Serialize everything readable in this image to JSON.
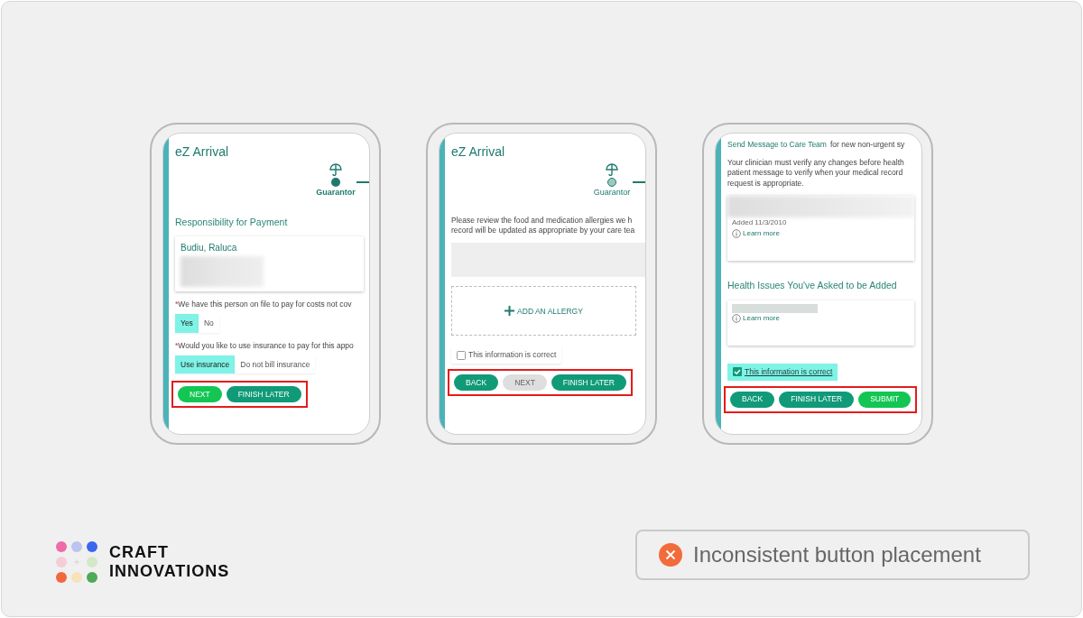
{
  "phones": [
    {
      "blocks": [
        {
          "kind": "title",
          "text": "eZ Arrival"
        },
        {
          "kind": "stepper",
          "label": "Guarantor",
          "current": true
        },
        {
          "kind": "heading",
          "text": "Responsibility for Payment"
        },
        {
          "kind": "person_card",
          "name": "Budiu, Raluca"
        },
        {
          "kind": "question",
          "marker": "*",
          "text": "We have this person on file to pay for costs not cov",
          "options": [
            {
              "label": "Yes",
              "selected": true
            },
            {
              "label": "No",
              "selected": false
            }
          ]
        },
        {
          "kind": "question",
          "marker": "*",
          "text": "Would you like to use insurance to pay for this appo",
          "options": [
            {
              "label": "Use insurance",
              "selected": true
            },
            {
              "label": "Do not bill insurance",
              "selected": false
            }
          ]
        }
      ],
      "buttons": [
        {
          "label": "NEXT",
          "kind": "primary"
        },
        {
          "label": "FINISH LATER",
          "kind": "secondary"
        }
      ]
    },
    {
      "blocks": [
        {
          "kind": "title",
          "text": "eZ Arrival"
        },
        {
          "kind": "stepper",
          "label": "Guarantor",
          "current": false
        },
        {
          "kind": "paragraph",
          "lines": [
            "Please review the food and medication allergies we h",
            "record will be updated as appropriate by your care tea"
          ]
        },
        {
          "kind": "empty_list"
        },
        {
          "kind": "add_box",
          "text": "ADD AN ALLERGY"
        },
        {
          "kind": "checkbox",
          "label": "This information is correct",
          "checked": false
        }
      ],
      "buttons": [
        {
          "label": "BACK",
          "kind": "secondary"
        },
        {
          "label": "NEXT",
          "kind": "disabled"
        },
        {
          "label": "FINISH LATER",
          "kind": "secondary"
        }
      ]
    },
    {
      "blocks": [
        {
          "kind": "link_line",
          "link": "Send Message to Care Team",
          "text": "for new non-urgent sy"
        },
        {
          "kind": "paragraph",
          "lines": [
            "Your clinician must verify any changes before health",
            "patient message to verify when your medical record",
            "request is appropriate."
          ]
        },
        {
          "kind": "item_card",
          "added": "Added 11/3/2010",
          "link": "Learn more"
        },
        {
          "kind": "heading",
          "text": "Health Issues You've Asked to be Added"
        },
        {
          "kind": "item_card",
          "link": "Learn more"
        },
        {
          "kind": "checkbox",
          "label": "This information is correct",
          "checked": true
        }
      ],
      "buttons": [
        {
          "label": "BACK",
          "kind": "secondary"
        },
        {
          "label": "FINISH LATER",
          "kind": "secondary"
        },
        {
          "label": "SUBMIT",
          "kind": "primary"
        }
      ]
    }
  ],
  "logo": {
    "lines": [
      "CRAFT",
      "INNOVATIONS"
    ]
  },
  "callout": {
    "text": "Inconsistent button placement"
  }
}
